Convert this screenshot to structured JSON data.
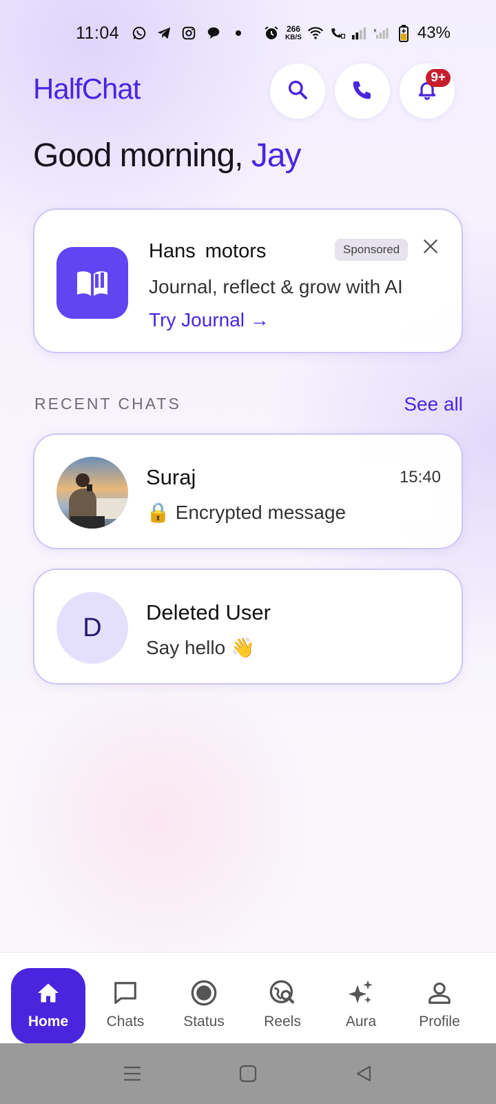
{
  "status_bar": {
    "time": "11:04",
    "speed_value": "266",
    "speed_unit": "KB/S",
    "battery_percent": "43%"
  },
  "header": {
    "brand": "HalfChat",
    "notification_badge": "9+"
  },
  "greeting": {
    "prefix": "Good morning, ",
    "name": "Jay"
  },
  "ad": {
    "title": "Hans motors",
    "sponsored_label": "Sponsored",
    "description": "Journal, reflect & grow with AI",
    "cta": "Try Journal →",
    "icon": "book-icon"
  },
  "recent_chats": {
    "section_title": "RECENT CHATS",
    "see_all": "See all",
    "items": [
      {
        "name": "Suraj",
        "time": "15:40",
        "message": "🔒 Encrypted message",
        "avatar": "photo"
      },
      {
        "name": "Deleted User",
        "time": "",
        "message": "Say hello 👋",
        "avatar_letter": "D"
      }
    ]
  },
  "bottom_nav": {
    "items": [
      {
        "label": "Home",
        "icon": "home-icon",
        "active": true
      },
      {
        "label": "Chats",
        "icon": "chat-icon",
        "active": false
      },
      {
        "label": "Status",
        "icon": "status-icon",
        "active": false
      },
      {
        "label": "Reels",
        "icon": "reels-icon",
        "active": false
      },
      {
        "label": "Aura",
        "icon": "sparkle-icon",
        "active": false
      },
      {
        "label": "Profile",
        "icon": "profile-icon",
        "active": false
      }
    ]
  },
  "colors": {
    "accent": "#4a25de",
    "badge": "#c81e2b",
    "ad_icon_bg": "#6145f2"
  }
}
